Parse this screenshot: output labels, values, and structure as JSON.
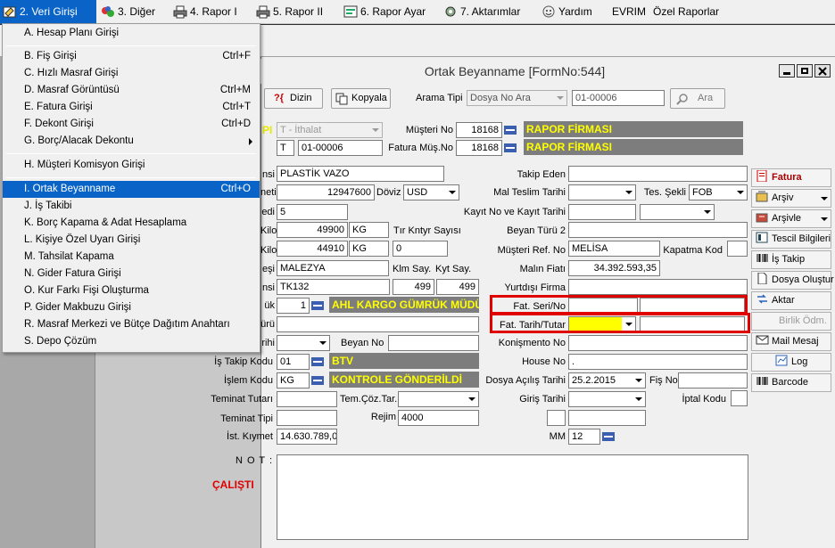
{
  "menubar": {
    "items": [
      {
        "label": "2. Veri Girişi",
        "icon": "data-entry-icon"
      },
      {
        "label": "3. Diğer",
        "icon": "other-icon"
      },
      {
        "label": "4. Rapor I",
        "icon": "printer-icon"
      },
      {
        "label": "5. Rapor II",
        "icon": "printer-icon"
      },
      {
        "label": "6. Rapor Ayar",
        "icon": "report-settings-icon"
      },
      {
        "label": "7. Aktarımlar",
        "icon": "transfer-icon"
      },
      {
        "label": "Yardım",
        "icon": "help-icon"
      },
      {
        "label": "EVRIM"
      },
      {
        "label": "Özel Raporlar"
      }
    ]
  },
  "dropdown": {
    "items": [
      {
        "label": "A. Hesap Planı Girişi",
        "shortcut": ""
      },
      {
        "label": "B. Fiş Girişi",
        "shortcut": "Ctrl+F"
      },
      {
        "label": "C. Hızlı Masraf Girişi",
        "shortcut": ""
      },
      {
        "label": "D. Masraf Görüntüsü",
        "shortcut": "Ctrl+M"
      },
      {
        "label": "E. Fatura Girişi",
        "shortcut": "Ctrl+T"
      },
      {
        "label": "F. Dekont Girişi",
        "shortcut": "Ctrl+D"
      },
      {
        "label": "G. Borç/Alacak Dekontu",
        "shortcut": ""
      },
      {
        "label": "H. Müşteri Komisyon Girişi",
        "shortcut": ""
      },
      {
        "label": "I. Ortak Beyanname",
        "shortcut": "Ctrl+O"
      },
      {
        "label": "J. İş Takibi",
        "shortcut": ""
      },
      {
        "label": "K. Borç Kapama & Adat Hesaplama",
        "shortcut": ""
      },
      {
        "label": "L. Kişiye Özel Uyarı Girişi",
        "shortcut": ""
      },
      {
        "label": "M. Tahsilat Kapama",
        "shortcut": ""
      },
      {
        "label": "N. Gider Fatura Girişi",
        "shortcut": ""
      },
      {
        "label": "O. Kur Farkı Fişi Oluşturma",
        "shortcut": ""
      },
      {
        "label": "P. Gider Makbuzu Girişi",
        "shortcut": ""
      },
      {
        "label": "R. Masraf Merkezi ve Bütçe Dağıtım Anahtarı",
        "shortcut": ""
      },
      {
        "label": "S. Depo Çözüm",
        "shortcut": ""
      }
    ]
  },
  "window": {
    "title": "Ortak Beyanname [FormNo:544]"
  },
  "toolbar": {
    "dizin": "Dizin",
    "kopyala": "Kopyala",
    "arama_tipi_label": "Arama Tipi",
    "arama_tipi_value": "Dosya No Ara",
    "search_value": "01-00006",
    "ara": "Ara"
  },
  "header": {
    "pi_fragment": "PI",
    "type_value": "T - İthalat",
    "t_value": "T",
    "file_no": "01-00006",
    "musteri_no_label": "Müşteri No",
    "musteri_no": "18168",
    "fatura_mus_label": "Fatura Müş.No",
    "fatura_mus_no": "18168",
    "firm1": "RAPOR FİRMASI",
    "firm2": "RAPOR FİRMASI"
  },
  "left_labels": {
    "l1": "nsi",
    "l2": "neti",
    "l3": "edi",
    "l4": "Kilo",
    "l5": "Kilo",
    "l6": "eşi",
    "l7": "nsi",
    "l8": "ük",
    "l9": "ürü",
    "l10": "rihi"
  },
  "left_fields": {
    "esya": "PLASTİK VAZO",
    "kiymet": "12947600",
    "doviz_label": "Döviz",
    "doviz": "USD",
    "adedi": "5",
    "brut": "49900",
    "brut_unit": "KG",
    "tir_label": "Tır Kntyr Sayısı",
    "net": "44910",
    "net_unit": "KG",
    "tir_value": "0",
    "ulke": "MALEZYA",
    "klm_label": "Klm Say.",
    "kyt_label": "Kyt Say.",
    "tasit": "TK132",
    "klm_value": "499",
    "kyt_value": "499",
    "gumruk_no": "1",
    "gumruk_name": "AHL KARGO GÜMRÜK MÜDÜ",
    "beyan_no_label": "Beyan No",
    "is_takip_label": "İş Takip Kodu",
    "is_takip_code": "01",
    "is_takip_name": "BTV",
    "islem_label": "İşlem Kodu",
    "islem_code": "KG",
    "islem_name": "KONTROLE GÖNDERİLDİ",
    "teminat_tutari_label": "Teminat Tutarı",
    "tem_coz_label": "Tem.Çöz.Tar.",
    "teminat_tipi_label": "Teminat Tipi",
    "rejim_label": "Rejim",
    "rejim": "4000",
    "ist_kiymet_label": "İst. Kıymet",
    "ist_kiymet": "14.630.789,0"
  },
  "right_fields": {
    "takip_eden_label": "Takip Eden",
    "mal_teslim_label": "Mal Teslim Tarihi",
    "tes_sekli_label": "Tes. Şekli",
    "tes_sekli": "FOB",
    "kayit_label": "Kayıt No ve Kayıt Tarihi",
    "beyan_turu_label": "Beyan Türü 2",
    "musteri_ref_label": "Müşteri Ref. No",
    "musteri_ref": "MELİSA",
    "kapatma_label": "Kapatma Kod",
    "malin_fiati_label": "Malın Fiatı",
    "malin_fiati": "34.392.593,35",
    "yurtdisi_label": "Yurtdışı Firma",
    "fat_seri_label": "Fat. Seri/No",
    "fat_tarih_label": "Fat. Tarih/Tutar",
    "konismento_label": "Konişmento No",
    "house_label": "House No",
    "house_value": ".",
    "dosya_acilis_label": "Dosya Açılış Tarihi",
    "dosya_acilis": "25.2.2015",
    "fis_no_label": "Fiş No",
    "giris_label": "Giriş Tarihi",
    "iptal_label": "İptal Kodu",
    "mm_label": "MM",
    "mm_value": "12"
  },
  "notes": {
    "not_label": "N O T :",
    "calisti": "ÇALIŞTI"
  },
  "side_buttons": [
    {
      "label": "Fatura",
      "icon": "invoice-icon"
    },
    {
      "label": "Arşiv",
      "icon": "archive-icon"
    },
    {
      "label": "Arşivle",
      "icon": "archive-save-icon"
    },
    {
      "label": "Tescil Bilgileri",
      "icon": "registration-icon"
    },
    {
      "label": "İş Takip",
      "icon": "barcode-icon"
    },
    {
      "label": "Dosya Oluştur",
      "icon": "document-icon"
    },
    {
      "label": "Aktar",
      "icon": "transfer-icon"
    },
    {
      "label": "Birlik Ödm.",
      "icon": ""
    },
    {
      "label": "Mail Mesaj",
      "icon": "mail-icon"
    },
    {
      "label": "Log",
      "icon": "log-icon"
    },
    {
      "label": "Barcode",
      "icon": "barcode-icon"
    }
  ],
  "colors": {
    "accent": "#0a64c8",
    "highlight_red": "#e00000",
    "yellow_field": "#ffff00",
    "bar_gray": "#7d7d7d"
  }
}
